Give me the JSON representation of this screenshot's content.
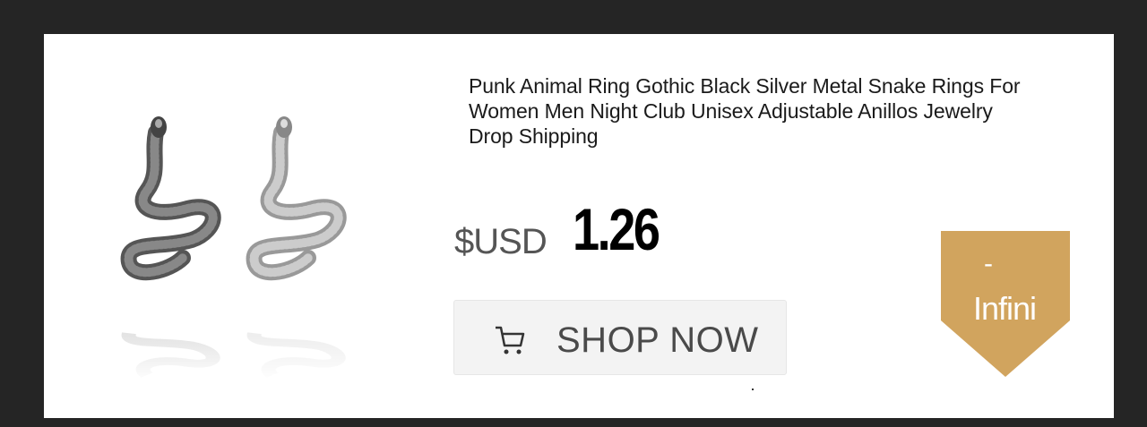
{
  "product": {
    "title": "Punk Animal Ring Gothic Black Silver Metal Snake Rings For Women Men Night Club Unisex Adjustable Anillos Jewelry Drop Shipping",
    "image_alt": "snake rings black and silver"
  },
  "pricing": {
    "currency": "$USD",
    "price": "1.26"
  },
  "cta": {
    "label": "SHOP NOW",
    "icon": "cart-icon"
  },
  "discount_badge": {
    "sign": "-",
    "text": "Infini",
    "color": "#d1a45e"
  },
  "colors": {
    "background": "#252525",
    "card": "#ffffff",
    "button_bg": "#f3f3f3",
    "badge": "#d1a45e"
  }
}
